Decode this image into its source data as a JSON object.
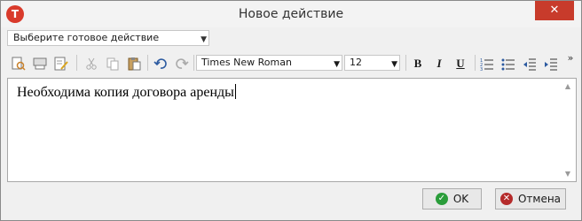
{
  "window": {
    "title": "Новое действие",
    "close_label": "✕",
    "app_icon_glyph": "Т"
  },
  "preset": {
    "label": "Выберите готовое действие"
  },
  "toolbar": {
    "font": "Times New Roman",
    "size": "12",
    "bold": "B",
    "italic": "I",
    "underline": "U",
    "more": "»"
  },
  "editor": {
    "text": "Необходима копия договора аренды"
  },
  "buttons": {
    "ok": "OK",
    "cancel": "Отмена"
  },
  "colors": {
    "ok_icon": "#2a9d3a",
    "cancel_icon": "#b52b2b",
    "title_close": "#c83b2b"
  }
}
